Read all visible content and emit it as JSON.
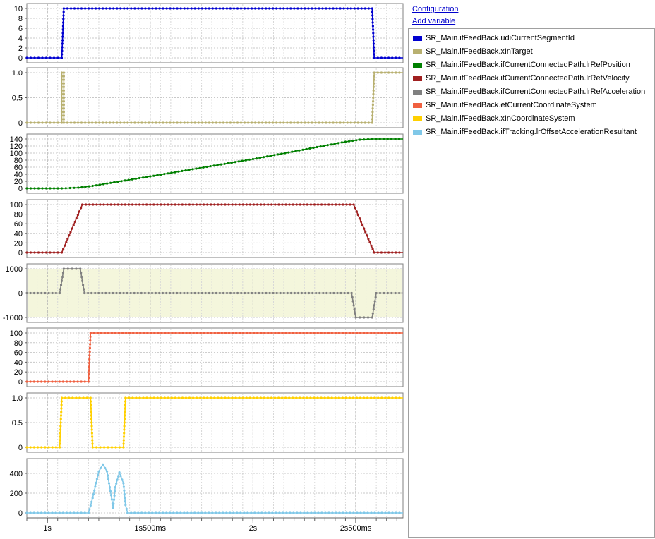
{
  "side_panel": {
    "configuration_link": "Configuration",
    "add_variable_link": "Add variable"
  },
  "legend": [
    {
      "label": "SR_Main.ifFeedBack.udiCurrentSegmentId",
      "color": "#0000d0"
    },
    {
      "label": "SR_Main.ifFeedBack.xInTarget",
      "color": "#b8b070"
    },
    {
      "label": "SR_Main.ifFeedBack.ifCurrentConnectedPath.lrRefPosition",
      "color": "#008000"
    },
    {
      "label": "SR_Main.ifFeedBack.ifCurrentConnectedPath.lrRefVelocity",
      "color": "#a02020"
    },
    {
      "label": "SR_Main.ifFeedBack.ifCurrentConnectedPath.lrRefAcceleration",
      "color": "#808080"
    },
    {
      "label": "SR_Main.ifFeedBack.etCurrentCoordinateSystem",
      "color": "#f06040"
    },
    {
      "label": "SR_Main.ifFeedBack.xInCoordinateSystem",
      "color": "#ffd000"
    },
    {
      "label": "SR_Main.ifFeedBack.ifTracking.lrOffsetAccelerationResultant",
      "color": "#80c8e8"
    }
  ],
  "chart_data": {
    "type": "line",
    "x_unit": "s",
    "xlim": [
      0.9,
      2.73
    ],
    "x_ticks": [
      {
        "value": 1.0,
        "label": "1s"
      },
      {
        "value": 1.5,
        "label": "1s500ms"
      },
      {
        "value": 2.0,
        "label": "2s"
      },
      {
        "value": 2.5,
        "label": "2s500ms"
      }
    ],
    "grid": true,
    "legend_placement": "right",
    "panels": [
      {
        "series": "SR_Main.ifFeedBack.udiCurrentSegmentId",
        "color": "#0000d0",
        "ylim": [
          0,
          10
        ],
        "y_ticks": [
          0,
          2,
          4,
          6,
          8,
          10
        ],
        "step": true,
        "points": [
          [
            0.9,
            0
          ],
          [
            1.07,
            0
          ],
          [
            1.08,
            10
          ],
          [
            2.58,
            10
          ],
          [
            2.59,
            0
          ],
          [
            2.73,
            0
          ]
        ]
      },
      {
        "series": "SR_Main.ifFeedBack.xInTarget",
        "color": "#b8b070",
        "ylim": [
          0,
          1.0
        ],
        "y_ticks": [
          0,
          0.5,
          1.0
        ],
        "y_tick_labels": [
          "0",
          "0.5",
          "1.0"
        ],
        "step": true,
        "points": [
          [
            0.9,
            0
          ],
          [
            1.07,
            0
          ],
          [
            1.07,
            1
          ],
          [
            1.08,
            1
          ],
          [
            1.08,
            0
          ],
          [
            2.58,
            0
          ],
          [
            2.59,
            1
          ],
          [
            2.73,
            1
          ]
        ]
      },
      {
        "series": "SR_Main.ifFeedBack.ifCurrentConnectedPath.lrRefPosition",
        "color": "#008000",
        "ylim": [
          0,
          140
        ],
        "y_ticks": [
          0,
          20,
          40,
          60,
          80,
          100,
          120,
          140
        ],
        "points": [
          [
            0.9,
            0
          ],
          [
            1.07,
            0
          ],
          [
            1.15,
            2
          ],
          [
            1.22,
            7
          ],
          [
            1.5,
            34
          ],
          [
            2.0,
            83
          ],
          [
            2.45,
            132
          ],
          [
            2.52,
            138
          ],
          [
            2.58,
            140
          ],
          [
            2.73,
            140
          ]
        ]
      },
      {
        "series": "SR_Main.ifFeedBack.ifCurrentConnectedPath.lrRefVelocity",
        "color": "#a02020",
        "ylim": [
          0,
          100
        ],
        "y_ticks": [
          0,
          20,
          40,
          60,
          80,
          100
        ],
        "points": [
          [
            0.9,
            0
          ],
          [
            1.07,
            0
          ],
          [
            1.17,
            100
          ],
          [
            2.49,
            100
          ],
          [
            2.59,
            0
          ],
          [
            2.73,
            0
          ]
        ]
      },
      {
        "series": "SR_Main.ifFeedBack.ifCurrentConnectedPath.lrRefAcceleration",
        "color": "#808080",
        "ylim": [
          -1000,
          1000
        ],
        "y_ticks": [
          -1000,
          0,
          1000
        ],
        "shaded_band": [
          -1000,
          1000
        ],
        "points": [
          [
            0.9,
            0
          ],
          [
            1.06,
            0
          ],
          [
            1.08,
            1000
          ],
          [
            1.16,
            1000
          ],
          [
            1.18,
            0
          ],
          [
            2.48,
            0
          ],
          [
            2.5,
            -1000
          ],
          [
            2.58,
            -1000
          ],
          [
            2.6,
            0
          ],
          [
            2.73,
            0
          ]
        ]
      },
      {
        "series": "SR_Main.ifFeedBack.etCurrentCoordinateSystem",
        "color": "#f06040",
        "ylim": [
          0,
          100
        ],
        "y_ticks": [
          0,
          20,
          40,
          60,
          80,
          100
        ],
        "step": true,
        "points": [
          [
            0.9,
            0
          ],
          [
            1.2,
            0
          ],
          [
            1.21,
            100
          ],
          [
            2.73,
            100
          ]
        ]
      },
      {
        "series": "SR_Main.ifFeedBack.xInCoordinateSystem",
        "color": "#ffd000",
        "ylim": [
          0,
          1.0
        ],
        "y_ticks": [
          0,
          0.5,
          1.0
        ],
        "y_tick_labels": [
          "0",
          "0.5",
          "1.0"
        ],
        "step": true,
        "points": [
          [
            0.9,
            0
          ],
          [
            1.06,
            0
          ],
          [
            1.07,
            1
          ],
          [
            1.21,
            1
          ],
          [
            1.22,
            0
          ],
          [
            1.37,
            0
          ],
          [
            1.38,
            1
          ],
          [
            2.73,
            1
          ]
        ]
      },
      {
        "series": "SR_Main.ifFeedBack.ifTracking.lrOffsetAccelerationResultant",
        "color": "#80c8e8",
        "ylim": [
          0,
          500
        ],
        "y_ticks": [
          0,
          200,
          400
        ],
        "points": [
          [
            0.9,
            0
          ],
          [
            1.2,
            0
          ],
          [
            1.22,
            150
          ],
          [
            1.25,
            420
          ],
          [
            1.27,
            490
          ],
          [
            1.29,
            420
          ],
          [
            1.31,
            180
          ],
          [
            1.32,
            50
          ],
          [
            1.33,
            260
          ],
          [
            1.35,
            410
          ],
          [
            1.37,
            300
          ],
          [
            1.38,
            80
          ],
          [
            1.39,
            0
          ],
          [
            2.73,
            0
          ]
        ]
      }
    ]
  }
}
